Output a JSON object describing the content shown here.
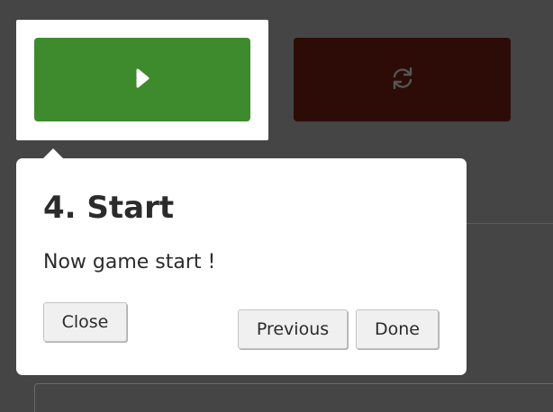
{
  "toolbar": {
    "play_icon": "play-icon",
    "reset_icon": "refresh-icon",
    "play_color": "#3e8b2e",
    "reset_color": "#2d0c08"
  },
  "tour": {
    "title": "4. Start",
    "description": "Now game start !",
    "close_label": "Close",
    "previous_label": "Previous",
    "done_label": "Done"
  }
}
